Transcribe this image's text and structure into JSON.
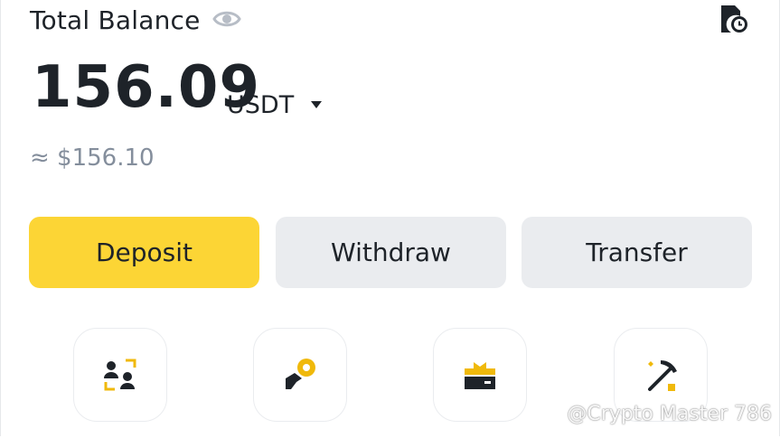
{
  "balance": {
    "label": "Total Balance",
    "amount": "156.09",
    "currency": "USDT",
    "fiat_equivalent": "≈ $156.10"
  },
  "actions": {
    "deposit": "Deposit",
    "withdraw": "Withdraw",
    "transfer": "Transfer"
  },
  "icons": {
    "visibility": "eye-icon",
    "history": "order-history-icon",
    "currency_dropdown": "caret-down-icon",
    "shortcuts": [
      "p2p-users-icon",
      "send-coin-icon",
      "gift-card-icon",
      "mining-pickaxe-icon"
    ]
  },
  "watermark": {
    "text": "@Crypto Master 786"
  },
  "colors": {
    "accent": "#fcd535",
    "text_primary": "#1e2329",
    "text_secondary": "#848e9c",
    "button_secondary": "#eaecef"
  }
}
